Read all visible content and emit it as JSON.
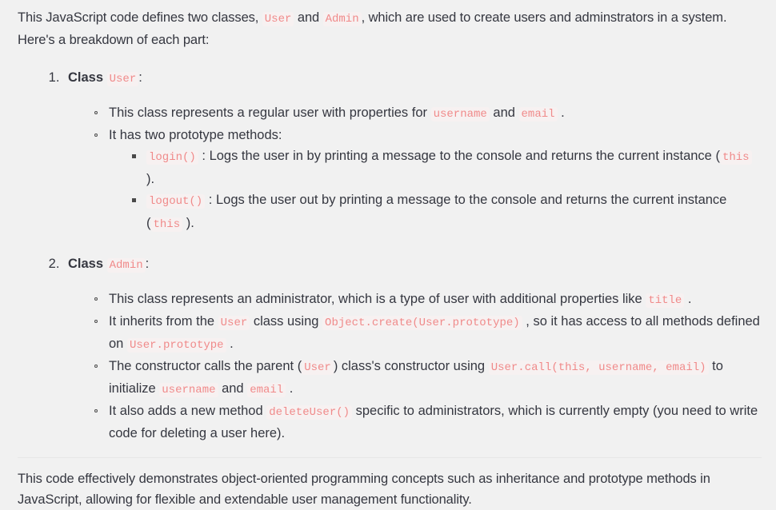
{
  "theme": {
    "page_background": "#f1f1f1",
    "text_color": "#353740",
    "code_color": "#f08a8a",
    "code_background": "#f7f1f1",
    "divider_color": "#e6e6e6"
  },
  "intro": {
    "part1": "This JavaScript code defines two classes, ",
    "code1": "User",
    "part2": " and ",
    "code2": "Admin",
    "part3": ", which are used to create users and adminstrators in a system. Here's a breakdown of each part:"
  },
  "sections": [
    {
      "number": "1.",
      "title_label": "Class",
      "title_code": "User",
      "title_suffix": ":",
      "bullets": [
        {
          "part1": "This class represents a regular user with properties for ",
          "code1": "username",
          "part2": " and ",
          "code2": "email",
          "part3": " ."
        },
        {
          "part1": "It has two prototype methods:",
          "subbullets": [
            {
              "code1": "login()",
              "part1": " : Logs the user in by printing a message to the console and returns the current instance (",
              "code2": "this",
              "part2": " )."
            },
            {
              "code1": "logout()",
              "part1": " : Logs the user out by printing a message to the console and returns the current instance (",
              "code2": "this",
              "part2": " )."
            }
          ]
        }
      ]
    },
    {
      "number": "2.",
      "title_label": "Class",
      "title_code": "Admin",
      "title_suffix": ":",
      "bullets": [
        {
          "part1": "This class represents an administrator, which is a type of user with additional properties like ",
          "code1": "title",
          "part2": " ."
        },
        {
          "part1": "It inherits from the ",
          "code1": "User",
          "part2": " class using ",
          "code2": "Object.create(User.prototype)",
          "part3": " , so it has access to all methods defined on ",
          "code3": "User.prototype",
          "part4": " ."
        },
        {
          "part1": "The constructor calls the parent (",
          "code1": "User",
          "part2": ") class's constructor using ",
          "code2": "User.call(this, username, email)",
          "part3": " to initialize ",
          "code3": "username",
          "part4": " and ",
          "code4": "email",
          "part5": " ."
        },
        {
          "part1": "It also adds a new method ",
          "code1": "deleteUser()",
          "part2": " specific to administrators, which is currently empty (you need to write code for deleting a user here)."
        }
      ]
    }
  ],
  "closing": {
    "text": "This code effectively demonstrates object-oriented programming concepts such as inheritance and prototype methods in JavaScript, allowing for flexible and extendable user management functionality."
  }
}
